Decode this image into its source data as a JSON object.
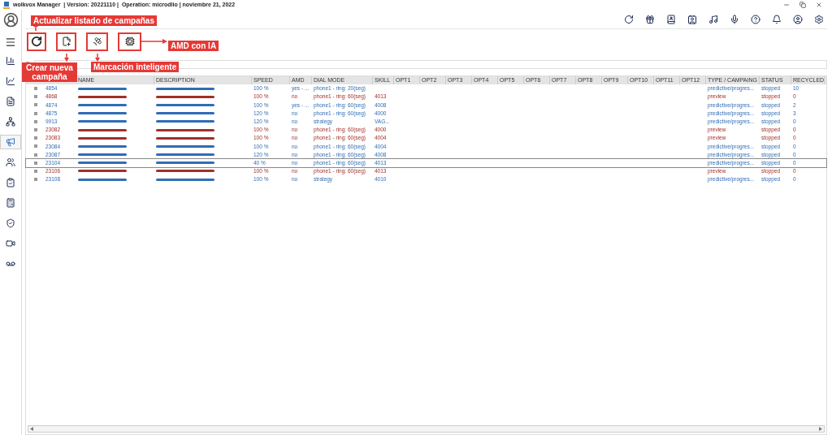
{
  "window": {
    "title": "wolkvox Manager  | Version: 20221110 |  Operation: microdlio | noviembre 21, 2022"
  },
  "sidebar": {
    "items": [
      {
        "selected": false
      },
      {
        "selected": false
      },
      {
        "selected": false
      },
      {
        "selected": false
      },
      {
        "selected": true
      },
      {
        "selected": false
      },
      {
        "selected": false
      },
      {
        "selected": false
      },
      {
        "selected": false
      },
      {
        "selected": false
      },
      {
        "selected": false
      }
    ]
  },
  "annotations": [
    {
      "kind": "above",
      "text": "Actualizar listado de campañas"
    },
    {
      "kind": "below",
      "text": "Crear nueva campaña"
    },
    {
      "kind": "below",
      "text": "Marcación inteligente"
    },
    {
      "kind": "right",
      "text": "AMD con IA"
    }
  ],
  "table": {
    "columns": [
      "NAME",
      "DESCRIPTION",
      "SPEED",
      "AMD",
      "DIAL MODE",
      "SKILL",
      "OPT1",
      "OPT2",
      "OPT3",
      "OPT4",
      "OPT5",
      "OPT6",
      "OPT7",
      "OPT8",
      "OPT9",
      "OPT10",
      "OPT11",
      "OPT12",
      "TYPE / CAMPAING",
      "STATUS",
      "RECYCLED"
    ],
    "rows": [
      {
        "id": "4854",
        "speed": "100 %",
        "amd": "yes - ...",
        "dial_mode": "phone1 - ring: 20(seg)",
        "skill": "",
        "type": "predictive/progres...",
        "status": "stopped",
        "recycled": "10",
        "color": "#2f6db5",
        "selected": false
      },
      {
        "id": "4868",
        "speed": "100 %",
        "amd": "no",
        "dial_mode": "phone1 - ring: 60(seg)",
        "skill": "4013",
        "type": "preview",
        "status": "stopped",
        "recycled": "0",
        "color": "#a0302a",
        "selected": false
      },
      {
        "id": "4874",
        "speed": "100 %",
        "amd": "yes - ...",
        "dial_mode": "phone1 - ring: 60(seg)",
        "skill": "4008",
        "type": "predictive/progres...",
        "status": "stopped",
        "recycled": "2",
        "color": "#2f6db5",
        "selected": false
      },
      {
        "id": "4875",
        "speed": "120 %",
        "amd": "no",
        "dial_mode": "phone1 - ring: 60(seg)",
        "skill": "4000",
        "type": "predictive/progres...",
        "status": "stopped",
        "recycled": "3",
        "color": "#2f6db5",
        "selected": false
      },
      {
        "id": "9913",
        "speed": "120 %",
        "amd": "no",
        "dial_mode": "strategy",
        "skill": "VAG...",
        "type": "predictive/progres...",
        "status": "stopped",
        "recycled": "0",
        "color": "#2f6db5",
        "selected": false
      },
      {
        "id": "23082",
        "speed": "100 %",
        "amd": "no",
        "dial_mode": "phone1 - ring: 60(seg)",
        "skill": "4000",
        "type": "preview",
        "status": "stopped",
        "recycled": "0",
        "color": "#a0302a",
        "selected": false
      },
      {
        "id": "23083",
        "speed": "100 %",
        "amd": "no",
        "dial_mode": "phone1 - ring: 60(seg)",
        "skill": "4004",
        "type": "preview",
        "status": "stopped",
        "recycled": "0",
        "color": "#a0302a",
        "selected": false
      },
      {
        "id": "23084",
        "speed": "100 %",
        "amd": "no",
        "dial_mode": "phone1 - ring: 60(seg)",
        "skill": "4004",
        "type": "predictive/progres...",
        "status": "stopped",
        "recycled": "0",
        "color": "#2f6db5",
        "selected": false
      },
      {
        "id": "23087",
        "speed": "120 %",
        "amd": "no",
        "dial_mode": "phone1 - ring: 60(seg)",
        "skill": "4008",
        "type": "predictive/progres...",
        "status": "stopped",
        "recycled": "0",
        "color": "#2f6db5",
        "selected": false
      },
      {
        "id": "23104",
        "speed": "40 %",
        "amd": "no",
        "dial_mode": "phone1 - ring: 60(seg)",
        "skill": "4013",
        "type": "predictive/progres...",
        "status": "stopped",
        "recycled": "0",
        "color": "#2f6db5",
        "selected": true
      },
      {
        "id": "23106",
        "speed": "100 %",
        "amd": "no",
        "dial_mode": "phone1 - ring: 60(seg)",
        "skill": "4013",
        "type": "preview",
        "status": "stopped",
        "recycled": "0",
        "color": "#a0302a",
        "selected": false
      },
      {
        "id": "23108",
        "speed": "100 %",
        "amd": "no",
        "dial_mode": "strategy",
        "skill": "4010",
        "type": "predictive/progres...",
        "status": "stopped",
        "recycled": "0",
        "color": "#2f6db5",
        "selected": false
      }
    ]
  }
}
